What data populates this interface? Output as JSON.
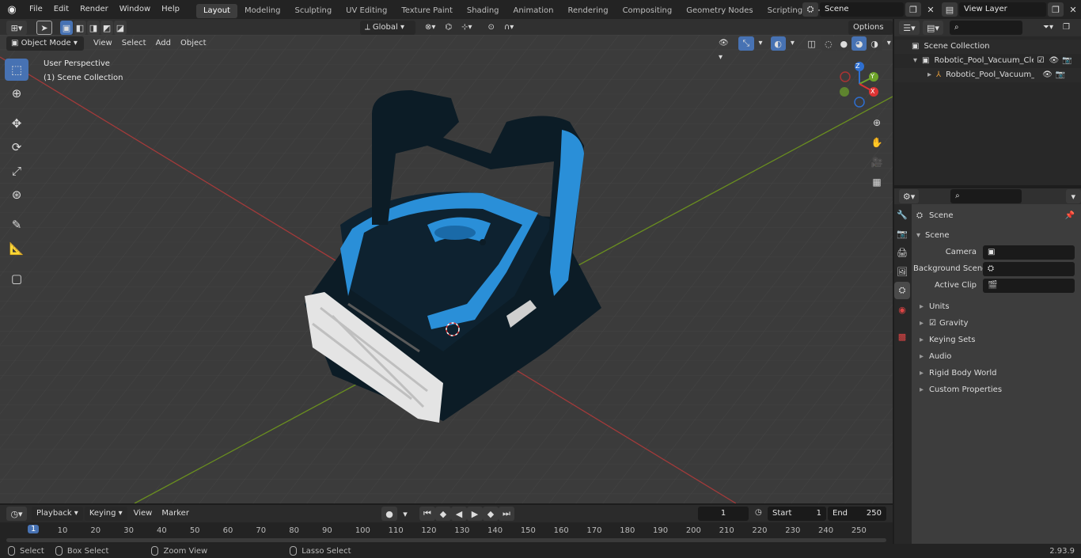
{
  "menus": [
    "File",
    "Edit",
    "Render",
    "Window",
    "Help"
  ],
  "workspace_tabs": [
    "Layout",
    "Modeling",
    "Sculpting",
    "UV Editing",
    "Texture Paint",
    "Shading",
    "Animation",
    "Rendering",
    "Compositing",
    "Geometry Nodes",
    "Scripting"
  ],
  "active_tab": "Layout",
  "scene_name": "Scene",
  "view_layer": "View Layer",
  "header": {
    "mode": "Object Mode",
    "view": "View",
    "select": "Select",
    "add": "Add",
    "object": "Object",
    "transform": "Global",
    "options": "Options"
  },
  "viewport": {
    "perspective": "User Perspective",
    "collection": "(1) Scene Collection"
  },
  "gizmo": {
    "x": "X",
    "y": "Y",
    "z": "Z"
  },
  "outliner": {
    "root": "Scene Collection",
    "items": [
      "Robotic_Pool_Vacuum_Cleaner",
      "Robotic_Pool_Vacuum_C"
    ]
  },
  "properties": {
    "title": "Scene",
    "section": "Scene",
    "camera_label": "Camera",
    "bg_label": "Background Scene",
    "clip_label": "Active Clip",
    "panels": [
      "Units",
      "Gravity",
      "Keying Sets",
      "Audio",
      "Rigid Body World",
      "Custom Properties"
    ]
  },
  "timeline": {
    "playback": "Playback",
    "keying": "Keying",
    "view": "View",
    "marker": "Marker",
    "current": "1",
    "start_label": "Start",
    "start": "1",
    "end_label": "End",
    "end": "250",
    "frames": [
      "1",
      "10",
      "20",
      "30",
      "40",
      "50",
      "60",
      "70",
      "80",
      "90",
      "100",
      "110",
      "120",
      "130",
      "140",
      "150",
      "160",
      "170",
      "180",
      "190",
      "200",
      "210",
      "220",
      "230",
      "240",
      "250"
    ]
  },
  "status": {
    "select": "Select",
    "box_select": "Box Select",
    "zoom": "Zoom View",
    "lasso": "Lasso Select",
    "version": "2.93.9"
  },
  "colors": {
    "accent": "#4772b3",
    "model_blue": "#2a8fd8",
    "model_dark": "#0c1c26"
  }
}
